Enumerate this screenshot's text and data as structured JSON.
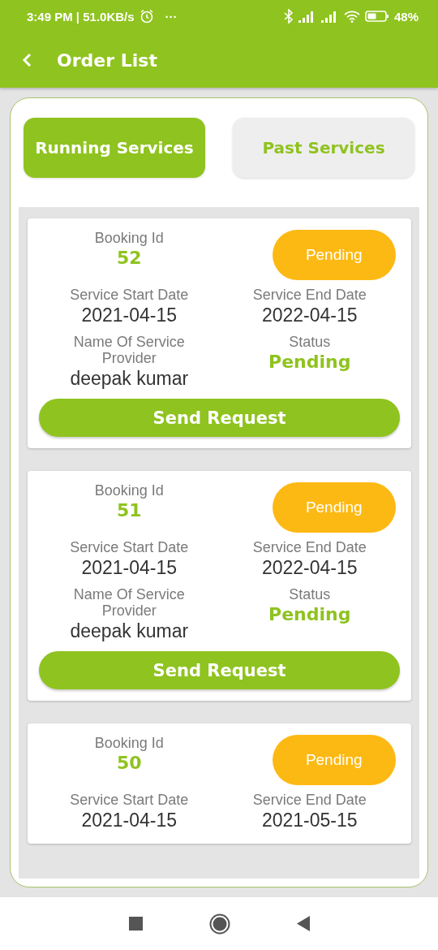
{
  "status_bar": {
    "time": "3:49 PM | 51.0KB/s",
    "more": "···",
    "battery": "48%"
  },
  "app_bar": {
    "title": "Order List"
  },
  "tabs": [
    {
      "label": "Running Services",
      "selected": true
    },
    {
      "label": "Past Services",
      "selected": false
    }
  ],
  "orders": [
    {
      "booking_label": "Booking Id",
      "booking_id": "52",
      "badge": "Pending",
      "start_label": "Service Start Date",
      "start_date": "2021-04-15",
      "end_label": "Service End Date",
      "end_date": "2022-04-15",
      "provider_label": "Name Of Service Provider",
      "provider": "deepak kumar",
      "status_label": "Status",
      "status": "Pending",
      "button": "Send Request"
    },
    {
      "booking_label": "Booking Id",
      "booking_id": "51",
      "badge": "Pending",
      "start_label": "Service Start Date",
      "start_date": "2021-04-15",
      "end_label": "Service End Date",
      "end_date": "2022-04-15",
      "provider_label": "Name Of Service Provider",
      "provider": "deepak kumar",
      "status_label": "Status",
      "status": "Pending",
      "button": "Send Request"
    },
    {
      "booking_label": "Booking Id",
      "booking_id": "50",
      "badge": "Pending",
      "start_label": "Service Start Date",
      "start_date": "2021-04-15",
      "end_label": "Service End Date",
      "end_date": "2021-05-15"
    }
  ]
}
